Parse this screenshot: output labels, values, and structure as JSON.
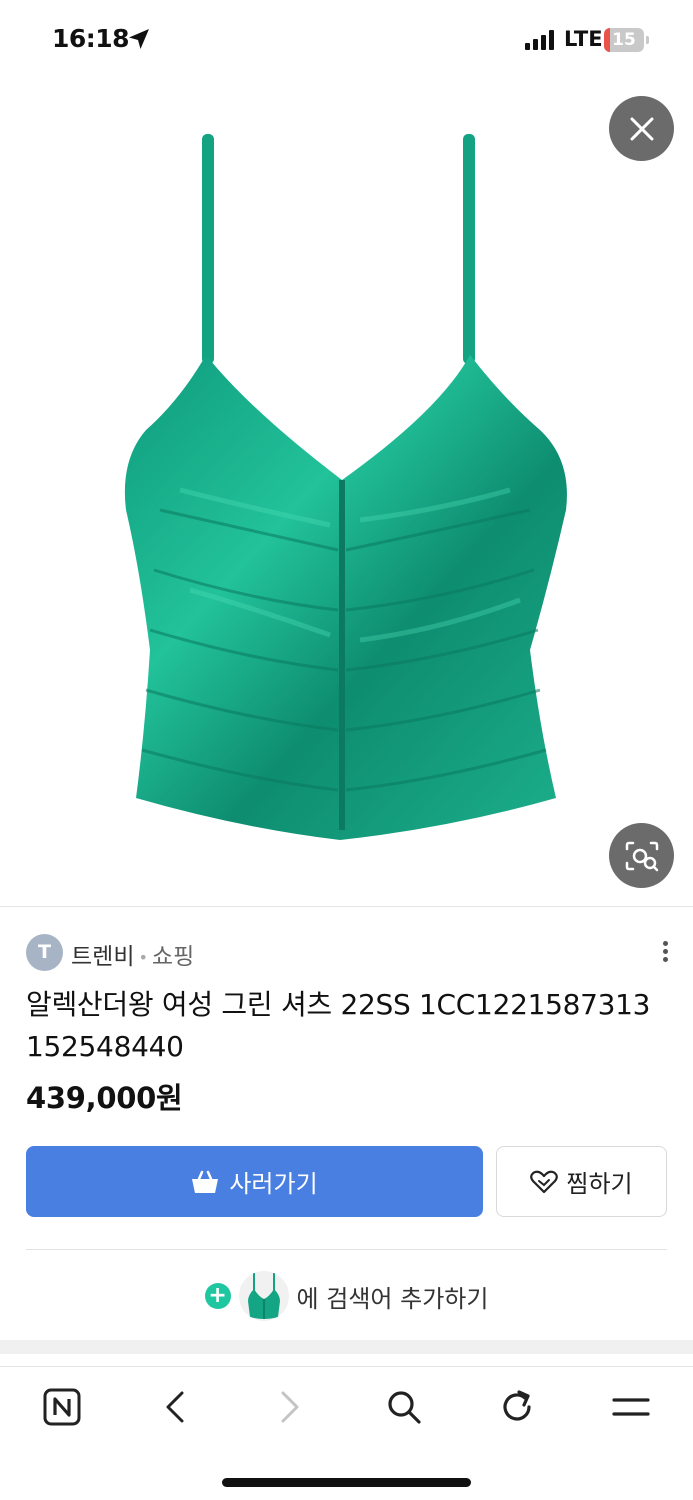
{
  "status_bar": {
    "time": "16:18",
    "network": "LTE",
    "battery_level": "15",
    "battery_fraction": 0.15,
    "battery_color": "#e9534a"
  },
  "product": {
    "image_icon": "green-ruched-camisole-image",
    "seller_initial": "T",
    "seller": "트렌비",
    "category": "쇼핑",
    "title": "알렉산더왕 여성 그린 셔츠 22SS 1CC1221587313 152548440",
    "price": "439,000원"
  },
  "actions": {
    "buy_label": "사러가기",
    "wish_label": "찜하기",
    "buy_color": "#4a7fe2"
  },
  "keyword": {
    "label": "에 검색어 추가하기",
    "plus_symbol": "+",
    "plus_color": "#1fc7a0"
  },
  "icons": {
    "close": "close-icon",
    "lens": "image-search-icon",
    "more": "more-vertical-icon",
    "bag": "shopping-bag-icon",
    "heart": "heart-icon",
    "nav": [
      "naver-home-icon",
      "back-icon",
      "forward-icon",
      "search-icon",
      "refresh-icon",
      "menu-icon"
    ]
  }
}
